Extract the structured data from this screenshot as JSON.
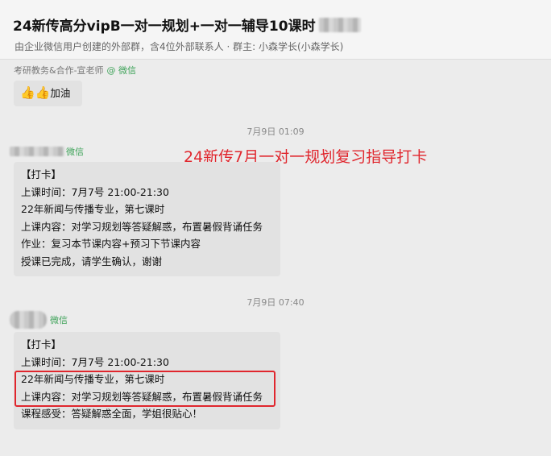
{
  "header": {
    "title": "24新传高分vipB一对一规划+一对一辅导10课时",
    "subtitle": "由企业微信用户创建的外部群，含4位外部联系人 · 群主: 小森学长(小森学长)"
  },
  "messages": {
    "m1": {
      "sender": "考研教务&合作-宣老师",
      "badge": "@ 微信",
      "text": "加油",
      "emoji": "👍👍"
    },
    "time1": "7月9日 01:09",
    "m2": {
      "badge": "微信",
      "lines": [
        "【打卡】",
        "上课时间：7月7号 21:00-21:30",
        "22年新闻与传播专业，第七课时",
        "上课内容：对学习规划等答疑解惑，布置暑假背诵任务",
        "作业：复习本节课内容+预习下节课内容",
        "授课已完成，请学生确认，谢谢"
      ]
    },
    "annotation": "24新传7月一对一规划复习指导打卡",
    "time2": "7月9日 07:40",
    "m3": {
      "badge": "微信",
      "lines": [
        "【打卡】",
        "上课时间：7月7号 21:00-21:30",
        "22年新闻与传播专业，第七课时",
        "上课内容：对学习规划等答疑解惑，布置暑假背诵任务",
        "课程感受：答疑解惑全面，学姐很贴心！"
      ]
    }
  },
  "colors": {
    "annotation": "#e0262d",
    "wechat_badge": "#3fa35a",
    "bubble": "#e2e2e2"
  }
}
